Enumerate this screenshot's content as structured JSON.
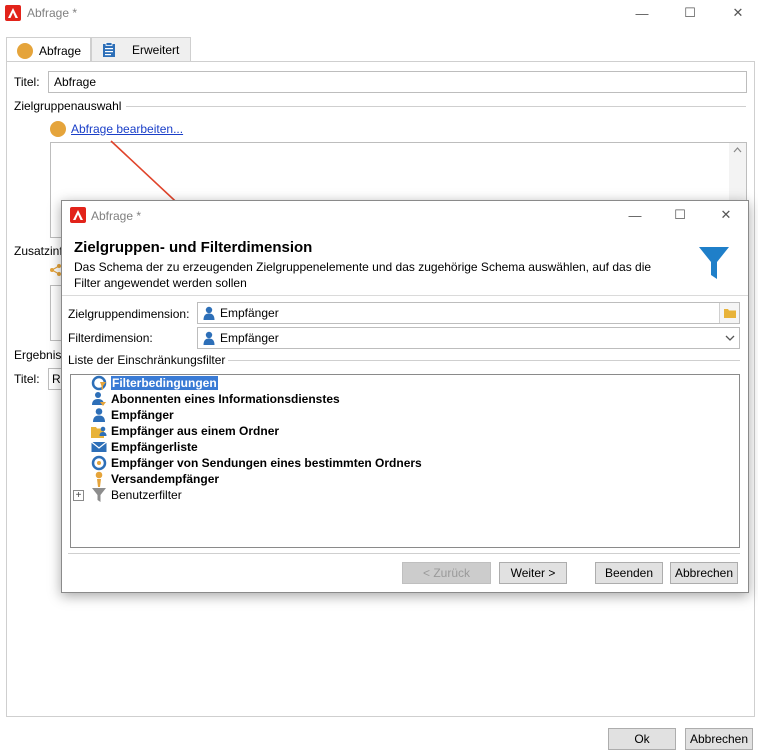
{
  "window": {
    "title": "Abfrage *",
    "minimize_glyph": "—",
    "maximize_glyph": "☐",
    "close_glyph": "✕"
  },
  "tabs": [
    {
      "label": "Abfrage",
      "icon": "orange-circle-icon",
      "active": true
    },
    {
      "label": "Erweitert",
      "icon": "clipboard-icon",
      "active": false
    }
  ],
  "form": {
    "title_label": "Titel:",
    "title_value": "Abfrage",
    "section_zielgruppe": "Zielgruppenauswahl",
    "edit_query_link": "Abfrage bearbeiten...",
    "section_zusatz_partial": "Zusatzinf",
    "section_ergebnis_partial": "Ergebnis",
    "title_label_2": "Titel:",
    "title_value_2_partial": "Re"
  },
  "footer": {
    "ok_label": "Ok",
    "cancel_label": "Abbrechen"
  },
  "dialog": {
    "title": "Abfrage *",
    "heading": "Zielgruppen- und Filterdimension",
    "description": "Das Schema der zu erzeugenden Zielgruppenelemente und das zugehörige Schema auswählen, auf das die Filter angewendet werden sollen",
    "target_dim_label": "Zielgruppendimension:",
    "target_dim_value": "Empfänger",
    "filter_dim_label": "Filterdimension:",
    "filter_dim_value": "Empfänger",
    "list_label": "Liste der Einschränkungsfilter",
    "tree_items": [
      {
        "label": "Filterbedingungen",
        "icon": "filter-conditions-icon",
        "selected": true,
        "bold": true
      },
      {
        "label": "Abonnenten eines Informationsdienstes",
        "icon": "subscribers-icon",
        "selected": false,
        "bold": true
      },
      {
        "label": "Empfänger",
        "icon": "person-icon",
        "selected": false,
        "bold": true
      },
      {
        "label": "Empfänger aus einem Ordner",
        "icon": "folder-person-icon",
        "selected": false,
        "bold": true
      },
      {
        "label": "Empfängerliste",
        "icon": "envelope-icon",
        "selected": false,
        "bold": true
      },
      {
        "label": "Empfänger von Sendungen eines bestimmten Ordners",
        "icon": "delivery-cycle-icon",
        "selected": false,
        "bold": true
      },
      {
        "label": "Versandempfänger",
        "icon": "delivery-person-icon",
        "selected": false,
        "bold": true
      },
      {
        "label": "Benutzerfilter",
        "icon": "funnel-gray-icon",
        "selected": false,
        "bold": false,
        "expandable": true
      }
    ],
    "expand_glyph": "+",
    "buttons": {
      "back": "< Zurück",
      "next": "Weiter >",
      "finish": "Beenden",
      "cancel": "Abbrechen"
    }
  },
  "colors": {
    "brand_red": "#e2231a",
    "orange": "#e5a43b",
    "link_blue": "#1a3fc8",
    "funnel_blue": "#1f7fc9",
    "selection_blue": "#3a7bd5",
    "arrow_red": "#e0442b"
  }
}
